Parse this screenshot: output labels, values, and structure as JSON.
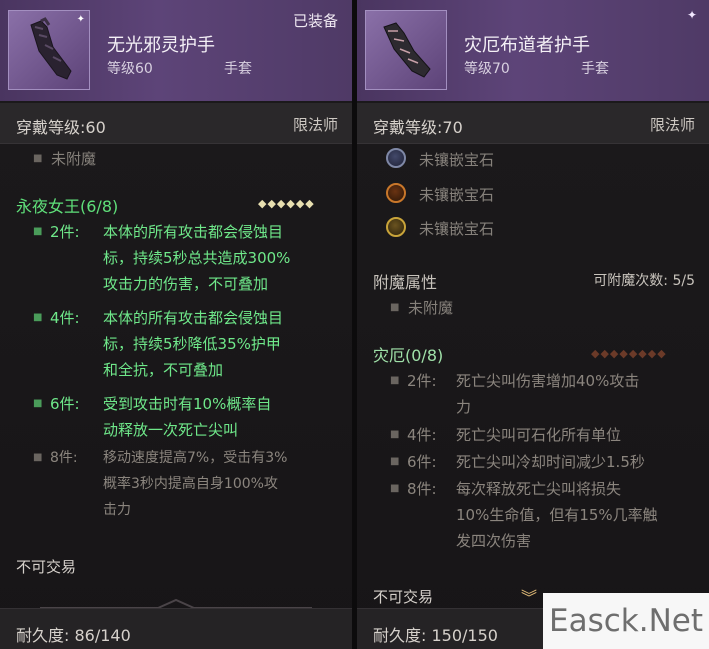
{
  "left": {
    "name": "无光邪灵护手",
    "level": "等级60",
    "slot": "手套",
    "equipped": "已装备",
    "req_label": "穿戴等级:60",
    "class_req": "限法师",
    "enchant_none": "未附魔",
    "set_name": "永夜女王(6/8)",
    "set_dots": "◆◆◆◆◆◆",
    "bonuses": [
      {
        "label": "2件:",
        "lines": [
          "本体的所有攻击都会侵蚀目",
          "标，持续5秒总共造成300%",
          "攻击力的伤害，不可叠加"
        ]
      },
      {
        "label": "4件:",
        "lines": [
          "本体的所有攻击都会侵蚀目",
          "标，持续5秒降低35%护甲",
          "和全抗，不可叠加"
        ]
      },
      {
        "label": "6件:",
        "lines": [
          "受到攻击时有10%概率自",
          "动释放一次死亡尖叫"
        ]
      },
      {
        "label": "8件:",
        "lines": [
          "移动速度提高7%，受击有3%",
          "概率3秒内提高自身100%攻",
          "击力"
        ]
      }
    ],
    "untradeable": "不可交易",
    "durability": "耐久度:  86/140"
  },
  "right": {
    "name": "灾厄布道者护手",
    "level": "等级70",
    "slot": "手套",
    "req_label": "穿戴等级:70",
    "class_req": "限法师",
    "gems": [
      "未镶嵌宝石",
      "未镶嵌宝石",
      "未镶嵌宝石"
    ],
    "enchant_label": "附魔属性",
    "enchant_count": "可附魔次数:  5/5",
    "enchant_none": "未附魔",
    "set_name": "灾厄(0/8)",
    "set_dots": "◆◆◆◆◆◆◆◆",
    "bonuses": [
      {
        "label": "2件:",
        "lines": [
          "死亡尖叫伤害增加40%攻击",
          "力"
        ]
      },
      {
        "label": "4件:",
        "lines": [
          "死亡尖叫可石化所有单位"
        ]
      },
      {
        "label": "6件:",
        "lines": [
          "死亡尖叫冷却时间减少1.5秒"
        ]
      },
      {
        "label": "8件:",
        "lines": [
          "每次释放死亡尖叫将损失",
          "10%生命值，但有15%几率触",
          "发四次伤害"
        ]
      }
    ],
    "untradeable": "不可交易",
    "durability": "耐久度:  150/150"
  },
  "watermark": "Easck.Net",
  "icons": {
    "rarity": "sparkle-icon",
    "item": "gauntlet-icon",
    "scroll": "chevron-down-icon"
  },
  "colors": {
    "set_active": "#6fe88a",
    "set_title": "#5fe07a",
    "inactive": "#8b857e",
    "header": "#5d4478"
  }
}
